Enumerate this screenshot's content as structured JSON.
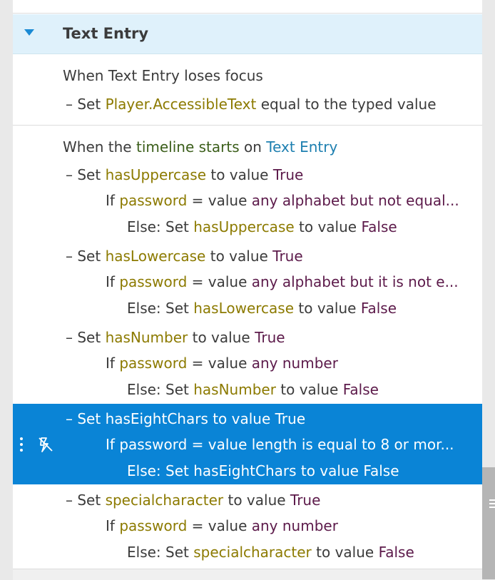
{
  "section": {
    "title": "Text Entry"
  },
  "trigger1": {
    "when_prefix": "When Text Entry loses focus",
    "action_dash": "–",
    "action_set": "Set",
    "action_var": "Player.AccessibleText",
    "action_rest": "equal to the typed value"
  },
  "trigger2": {
    "when_prefix": "When the",
    "event": "timeline starts",
    "on_word": "on",
    "object": "Text Entry"
  },
  "actions": [
    {
      "set_word": "Set",
      "var": "hasUppercase",
      "to_value": "to value",
      "value": "True",
      "if_word": "If",
      "cond_var": "password",
      "cond_op": "= value",
      "cond_val": "any alphabet but not equal...",
      "else_prefix": "Else: Set",
      "else_var": "hasUppercase",
      "else_to_value": "to value",
      "else_value": "False"
    },
    {
      "set_word": "Set",
      "var": "hasLowercase",
      "to_value": "to value",
      "value": "True",
      "if_word": "If",
      "cond_var": "password",
      "cond_op": "= value",
      "cond_val": "any alphabet but it is not e...",
      "else_prefix": "Else: Set",
      "else_var": "hasLowercase",
      "else_to_value": "to value",
      "else_value": "False"
    },
    {
      "set_word": "Set",
      "var": "hasNumber",
      "to_value": "to value",
      "value": "True",
      "if_word": "If",
      "cond_var": "password",
      "cond_op": "= value",
      "cond_val": "any number",
      "else_prefix": "Else: Set",
      "else_var": "hasNumber",
      "else_to_value": "to value",
      "else_value": "False"
    },
    {
      "set_word": "Set",
      "var": "hasEightChars",
      "to_value": "to value",
      "value": "True",
      "if_word": "If",
      "cond_var": "password",
      "cond_op": "= value",
      "cond_val": "length is equal to 8 or mor...",
      "else_prefix": "Else: Set",
      "else_var": "hasEightChars",
      "else_to_value": "to value",
      "else_value": "False"
    },
    {
      "set_word": "Set",
      "var": "specialcharacter",
      "to_value": "to value",
      "value": "True",
      "if_word": "If",
      "cond_var": "password",
      "cond_op": "= value",
      "cond_val": "any number",
      "else_prefix": "Else: Set",
      "else_var": "specialcharacter",
      "else_to_value": "to value",
      "else_value": "False"
    }
  ],
  "colors": {
    "header_bg": "#dff1fb",
    "selected_bg": "#0a84d6",
    "variable": "#8c7a00",
    "value": "#5c1a4a",
    "object": "#1d7fb0"
  }
}
